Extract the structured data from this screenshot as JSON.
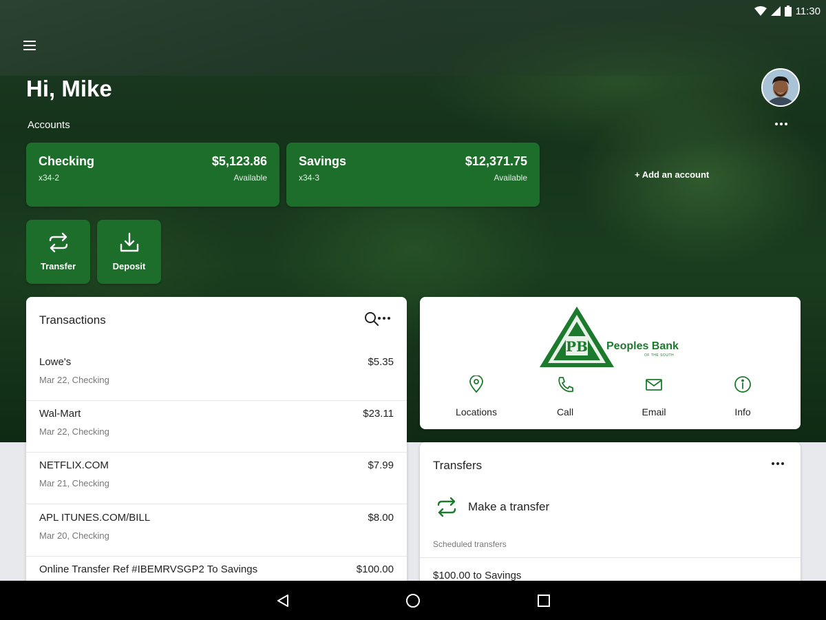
{
  "status_bar": {
    "time": "11:30"
  },
  "header": {
    "greeting": "Hi, Mike",
    "accounts_label": "Accounts",
    "add_account": "+ Add an account"
  },
  "accounts": [
    {
      "name": "Checking",
      "number": "x34-2",
      "amount": "$5,123.86",
      "availability": "Available"
    },
    {
      "name": "Savings",
      "number": "x34-3",
      "amount": "$12,371.75",
      "availability": "Available"
    }
  ],
  "actions": [
    {
      "label": "Transfer",
      "icon": "transfer-icon"
    },
    {
      "label": "Deposit",
      "icon": "deposit-icon"
    }
  ],
  "transactions": {
    "title": "Transactions",
    "rows": [
      {
        "description": "Lowe's",
        "detail": "Mar 22, Checking",
        "amount": "$5.35"
      },
      {
        "description": "Wal-Mart",
        "detail": "Mar 22, Checking",
        "amount": "$23.11"
      },
      {
        "description": "NETFLIX.COM",
        "detail": "Mar 21, Checking",
        "amount": "$7.99"
      },
      {
        "description": "APL ITUNES.COM/BILL",
        "detail": "Mar 20, Checking",
        "amount": "$8.00"
      },
      {
        "description": "Online Transfer Ref #IBEMRVSGP2 To Savings",
        "detail": "",
        "amount": "$100.00"
      }
    ]
  },
  "bank": {
    "logo_initials": "PB",
    "name": "Peoples Bank",
    "tagline": "OF THE SOUTH",
    "contacts": [
      {
        "label": "Locations",
        "icon": "location-pin-icon"
      },
      {
        "label": "Call",
        "icon": "phone-icon"
      },
      {
        "label": "Email",
        "icon": "email-icon"
      },
      {
        "label": "Info",
        "icon": "info-icon"
      }
    ]
  },
  "transfers": {
    "title": "Transfers",
    "make_transfer": "Make a transfer",
    "scheduled_label": "Scheduled transfers",
    "scheduled": [
      "$100.00 to Savings"
    ]
  },
  "colors": {
    "brand_green": "#1c6e2a",
    "logo_green": "#1c7a2c"
  }
}
